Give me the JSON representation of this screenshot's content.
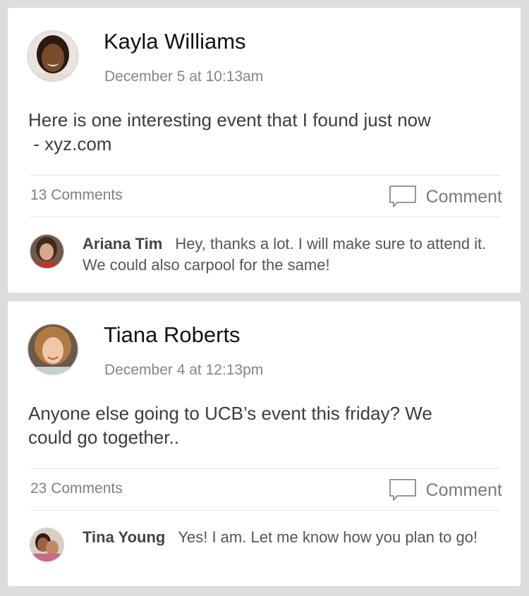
{
  "posts": [
    {
      "author": "Kayla Williams",
      "timestamp": "December 5 at 10:13am",
      "text_line1": "Here is one interesting event that I found just now",
      "text_line2": " - xyz.com",
      "comment_count": "13 Comments",
      "comment_label": "Comment",
      "top_comment": {
        "author": "Ariana Tim",
        "text": "Hey, thanks a lot. I will make sure to attend it. We could also carpool for the same!"
      }
    },
    {
      "author": "Tiana Roberts",
      "timestamp": "December 4 at 12:13pm",
      "text_line1": "Anyone else going to UCB’s event this friday? We",
      "text_line2": "could go together..",
      "comment_count": "23 Comments",
      "comment_label": "Comment",
      "top_comment": {
        "author": "Tina Young",
        "text": "Yes! I am. Let me know how you plan to go!"
      }
    }
  ],
  "icons": {
    "comment": "speech-bubble-icon"
  },
  "colors": {
    "background": "#dddddd",
    "card": "#ffffff",
    "secondary_text": "#858585"
  }
}
